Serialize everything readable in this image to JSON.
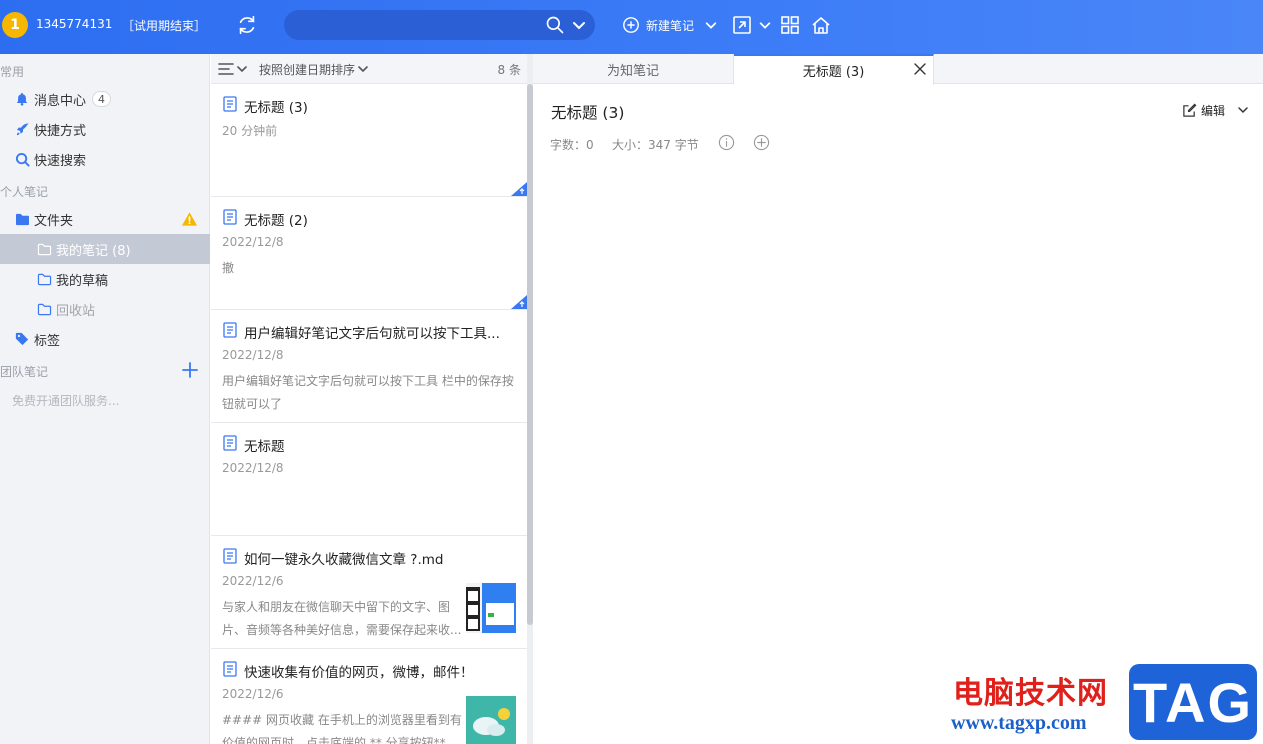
{
  "topbar": {
    "avatar_text": "1",
    "username": "1345774131",
    "trial_status": "［试用期结束］",
    "search_placeholder": "",
    "new_note_label": "新建笔记"
  },
  "sidebar": {
    "section_common": "常用",
    "messages": {
      "label": "消息中心",
      "count": "4"
    },
    "shortcuts": "快捷方式",
    "quick_search": "快速搜索",
    "section_personal": "个人笔记",
    "folders": "文件夹",
    "my_notes": "我的笔记 (8)",
    "my_drafts": "我的草稿",
    "recycle_bin": "回收站",
    "tags": "标签",
    "section_team": "团队笔记",
    "team_hint": "免费开通团队服务..."
  },
  "notelist": {
    "sort_label": "按照创建日期排序",
    "count": "8 条",
    "notes": [
      {
        "title": "无标题 (3)",
        "date": "20 分钟前",
        "snippet": ""
      },
      {
        "title": "无标题 (2)",
        "date": "2022/12/8",
        "snippet": "撤"
      },
      {
        "title": "用户编辑好笔记文字后句就可以按下工具...",
        "date": "2022/12/8",
        "snippet": "用户编辑好笔记文字后句就可以按下工具 栏中的保存按钮就可以了"
      },
      {
        "title": "无标题",
        "date": "2022/12/8",
        "snippet": ""
      },
      {
        "title": "如何一键永久收藏微信文章 ?.md",
        "date": "2022/12/6",
        "snippet": " 与家人和朋友在微信聊天中留下的文字、图片、音频等各种美好信息，需要保存起来收..."
      },
      {
        "title": "快速收集有价值的网页，微博，邮件！",
        "date": "2022/12/6",
        "snippet": " #### 网页收藏 在手机上的浏览器里看到有价值的网页时，点击底端的 ** 分享按钮** ..."
      }
    ]
  },
  "editor": {
    "tab_1": "为知笔记",
    "tab_2": "无标题 (3)",
    "title": "无标题 (3)",
    "word_count": "字数：0",
    "size": "大小：347 字节",
    "edit_label": "编辑"
  },
  "watermark": {
    "site_name": "电脑技术网",
    "url": "www.tagxp.com",
    "tag": "TAG"
  },
  "colors": {
    "topbar": "#3275f4",
    "accent": "#3a78f2",
    "warning": "#f5b700",
    "active_item": "#c4c9d6"
  }
}
